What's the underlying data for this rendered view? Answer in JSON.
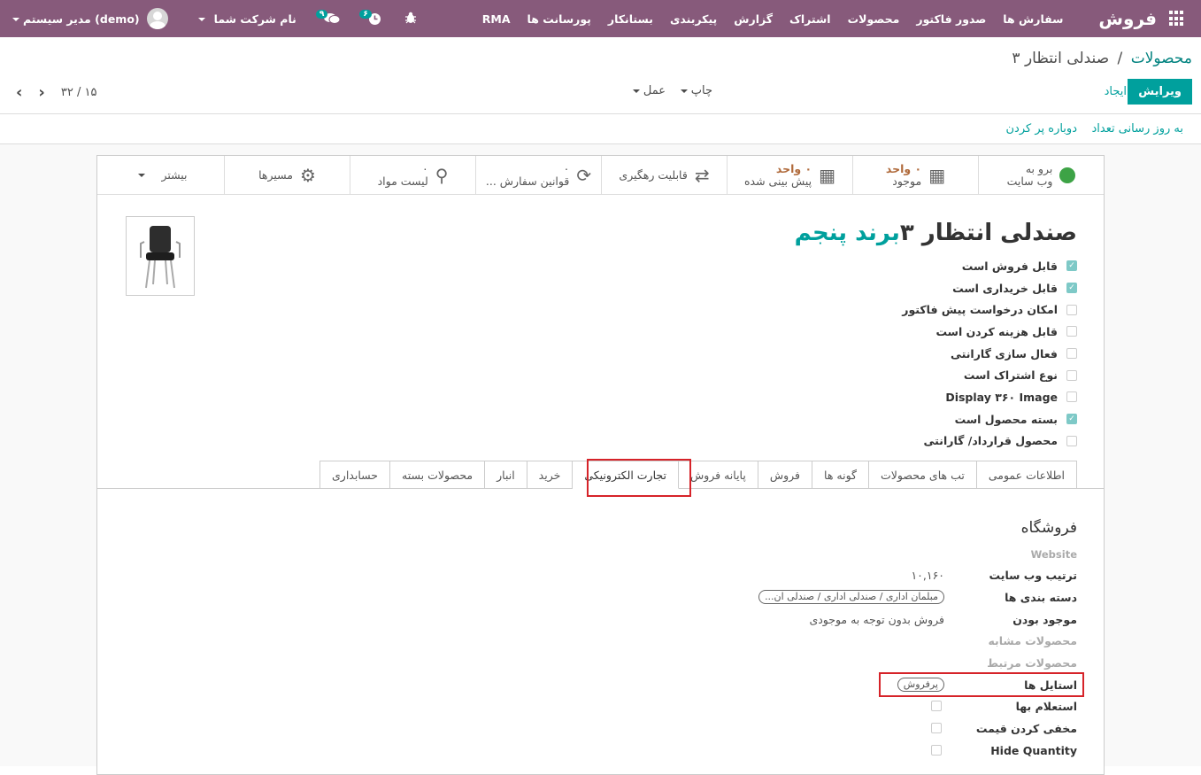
{
  "navbar": {
    "brand": "فروش",
    "menu": [
      "سفارش ها",
      "صدور فاکتور",
      "محصولات",
      "اشتراک",
      "گزارش",
      "پیکربندی",
      "بستانکار",
      "پورسانت ها",
      "RMA"
    ],
    "user": "مدیر سیستم (demo)",
    "company": "نام شرکت شما",
    "messages_count": "۹",
    "activities_count": "۶"
  },
  "control_panel": {
    "breadcrumb_parent": "محصولات",
    "breadcrumb_sep": "/",
    "breadcrumb_current": "صندلی انتظار ۳",
    "edit_label": "ویرایش",
    "create_label": "ایجاد",
    "print_label": "چاپ",
    "action_label": "عمل",
    "pager": "۱۵ / ۳۲"
  },
  "statusbar": {
    "update_qty": "به روز رسانی تعداد",
    "refill": "دوباره پر کردن"
  },
  "buttonbox": {
    "website": [
      "برو به",
      "وب سایت"
    ],
    "on_hand": {
      "value": "۰ واحد",
      "label": "موجود"
    },
    "forecast": {
      "value": "۰ واحد",
      "label": "پیش بینی شده"
    },
    "traceability": "قابلیت رهگیری",
    "reorder": {
      "value": "۰",
      "label": "قوانین سفارش ..."
    },
    "bom": {
      "value": "۰",
      "label": "لیست مواد"
    },
    "routes": "مسیرها",
    "more": "بیشتر"
  },
  "product": {
    "name": "صندلی انتظار ۳",
    "brand": "برند پنجم"
  },
  "checkboxes": [
    {
      "label": "قابل فروش است",
      "checked": true
    },
    {
      "label": "قابل خریداری است",
      "checked": true
    },
    {
      "label": "امکان درخواست پیش فاکتور",
      "checked": false
    },
    {
      "label": "قابل هزینه کردن است",
      "checked": false
    },
    {
      "label": "فعال سازی گارانتی",
      "checked": false
    },
    {
      "label": "نوع اشتراک است",
      "checked": false
    },
    {
      "label": "Display ۳۶۰ Image",
      "checked": false
    },
    {
      "label": "بسته محصول است",
      "checked": true
    },
    {
      "label": "محصول قرارداد/ گارانتی",
      "checked": false
    }
  ],
  "tabs": [
    "اطلاعات عمومی",
    "تب های محصولات",
    "گونه ها",
    "فروش",
    "پایانه فروش",
    "تجارت الکترونیکی",
    "خرید",
    "انبار",
    "محصولات بسته",
    "حسابداری"
  ],
  "shop": {
    "title": "فروشگاه",
    "subtitle": "Website",
    "website_sequence_label": "ترتیب وب سایت",
    "website_sequence": "۱۰,۱۶۰",
    "categories_label": "دسته بندی ها",
    "categories": "مبلمان اداری / صندلی اداری / صندلی ان...",
    "availability_label": "موجود بودن",
    "availability": "فروش بدون توجه به موجودی",
    "alternative_label": "محصولات مشابه",
    "accessory_label": "محصولات مرتبط",
    "styles_label": "استایل ها",
    "styles_tag": "پرفروش",
    "price_inquiry_label": "استعلام بها",
    "hide_price_label": "مخفی کردن قیمت",
    "hide_qty_label": "Hide Quantity"
  }
}
